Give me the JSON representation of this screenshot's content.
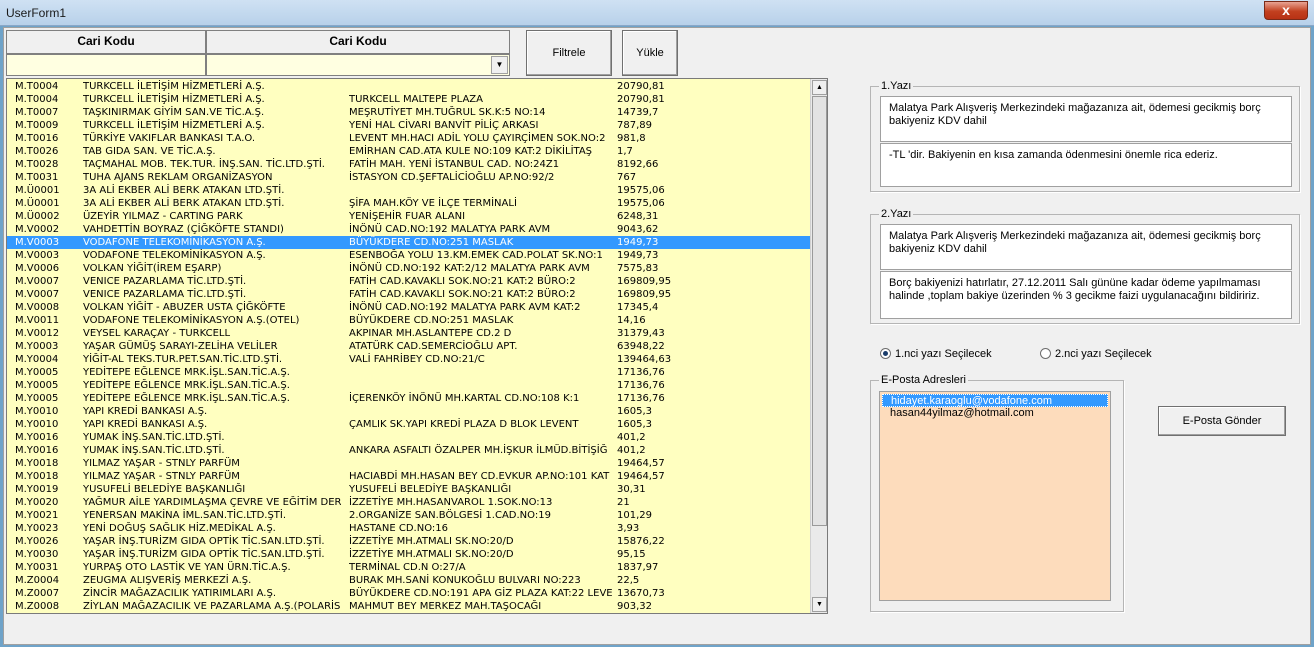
{
  "window": {
    "title": "UserForm1",
    "close_label": "x"
  },
  "filter": {
    "header1": "Cari Kodu",
    "header2": "Cari Kodu",
    "filter_button": "Filtrele",
    "load_button": "Yükle"
  },
  "list": {
    "selected_index": 12,
    "rows": [
      [
        "M.T0004",
        "TURKCELL İLETİŞİM HİZMETLERİ A.Ş.",
        "",
        "20790,81"
      ],
      [
        "M.T0004",
        "TURKCELL İLETİŞİM HİZMETLERİ A.Ş.",
        "TURKCELL MALTEPE PLAZA",
        "20790,81"
      ],
      [
        "M.T0007",
        "TAŞKINIRMAK GİYİM SAN.VE TİC.A.Ş.",
        "MEŞRUTİYET MH.TUĞRUL SK.K:5 NO:14",
        "14739,7"
      ],
      [
        "M.T0009",
        "TURKCELL İLETİŞİM HİZMETLERİ A.Ş.",
        "YENİ HAL CİVARI BANVİT PİLİÇ ARKASI",
        "787,89"
      ],
      [
        "M.T0016",
        "TÜRKİYE VAKIFLAR BANKASI T.A.O.",
        "LEVENT MH.HACI ADİL YOLU ÇAYIRÇİMEN SOK.NO:2",
        "981,8"
      ],
      [
        "M.T0026",
        "TAB GIDA SAN. VE TİC.A.Ş.",
        "EMİRHAN CAD.ATA KULE NO:109 KAT:2 DİKİLİTAŞ",
        "1,7"
      ],
      [
        "M.T0028",
        "TAÇMAHAL MOB. TEK.TUR. İNŞ.SAN. TİC.LTD.ŞTİ.",
        "FATİH MAH. YENİ İSTANBUL CAD. NO:24Z1",
        "8192,66"
      ],
      [
        "M.T0031",
        "TUHA AJANS REKLAM ORGANİZASYON",
        "İSTASYON CD.ŞEFTALİCİOĞLU AP.NO:92/2",
        "767"
      ],
      [
        "M.Ü0001",
        "3A ALİ EKBER ALİ BERK ATAKAN LTD.ŞTİ.",
        "",
        "19575,06"
      ],
      [
        "M.Ü0001",
        "3A ALİ EKBER ALİ BERK ATAKAN LTD.ŞTİ.",
        "ŞİFA MAH.KÖY VE İLÇE TERMİNALİ",
        "19575,06"
      ],
      [
        "M.Ü0002",
        "ÜZEYİR YILMAZ - CARTING PARK",
        "YENİŞEHİR FUAR ALANI",
        "6248,31"
      ],
      [
        "M.V0002",
        "VAHDETTİN BOYRAZ (ÇİĞKÖFTE STANDI)",
        "İNÖNÜ CAD.NO:192 MALATYA PARK AVM",
        "9043,62"
      ],
      [
        "M.V0003",
        "VODAFONE TELEKOMİNİKASYON A.Ş.",
        "BÜYÜKDERE CD.NO:251 MASLAK",
        "1949,73"
      ],
      [
        "M.V0003",
        "VODAFONE TELEKOMİNİKASYON A.Ş.",
        "ESENBOĞA YOLU 13.KM.EMEK CAD.POLAT SK.NO:1",
        "1949,73"
      ],
      [
        "M.V0006",
        "VOLKAN YİĞİT(İREM EŞARP)",
        "İNÖNÜ CD.NO:192 KAT:2/12 MALATYA PARK AVM",
        "7575,83"
      ],
      [
        "M.V0007",
        "VENICE PAZARLAMA TİC.LTD.ŞTİ.",
        "FATİH CAD.KAVAKLI SOK.NO:21 KAT:2 BÜRO:2",
        "169809,95"
      ],
      [
        "M.V0007",
        "VENICE PAZARLAMA TİC.LTD.ŞTİ.",
        "FATİH CAD.KAVAKLI SOK.NO:21 KAT:2 BÜRO:2",
        "169809,95"
      ],
      [
        "M.V0008",
        "VOLKAN YİĞİT - ABUZER USTA ÇİĞKÖFTE",
        "İNÖNÜ CAD.NO:192 MALATYA PARK AVM KAT:2",
        "17345,4"
      ],
      [
        "M.V0011",
        "VODAFONE TELEKOMİNİKASYON A.Ş.(OTEL)",
        "BÜYÜKDERE CD.NO:251 MASLAK",
        "14,16"
      ],
      [
        "M.V0012",
        "VEYSEL KARAÇAY - TURKCELL",
        "AKPINAR MH.ASLANTEPE CD.2 D",
        "31379,43"
      ],
      [
        "M.Y0003",
        "YAŞAR GÜMÜŞ SARAYI-ZELİHA VELİLER",
        "ATATÜRK CAD.SEMERCİOĞLU APT.",
        "63948,22"
      ],
      [
        "M.Y0004",
        "YİĞİT-AL TEKS.TUR.PET.SAN.TİC.LTD.ŞTİ.",
        "VALİ FAHRİBEY CD.NO:21/C",
        "139464,63"
      ],
      [
        "M.Y0005",
        "YEDİTEPE EĞLENCE MRK.İŞL.SAN.TİC.A.Ş.",
        "",
        "17136,76"
      ],
      [
        "M.Y0005",
        "YEDİTEPE EĞLENCE MRK.İŞL.SAN.TİC.A.Ş.",
        "",
        "17136,76"
      ],
      [
        "M.Y0005",
        "YEDİTEPE EĞLENCE MRK.İŞL.SAN.TİC.A.Ş.",
        "İÇERENKÖY İNÖNÜ MH.KARTAL CD.NO:108 K:1",
        "17136,76"
      ],
      [
        "M.Y0010",
        "YAPI KREDİ BANKASI A.Ş.",
        "",
        "1605,3"
      ],
      [
        "M.Y0010",
        "YAPI KREDİ BANKASI A.Ş.",
        "ÇAMLIK SK.YAPI KREDİ PLAZA D BLOK LEVENT",
        "1605,3"
      ],
      [
        "M.Y0016",
        "YUMAK İNŞ.SAN.TİC.LTD.ŞTİ.",
        "",
        "401,2"
      ],
      [
        "M.Y0016",
        "YUMAK İNŞ.SAN.TİC.LTD.ŞTİ.",
        "ANKARA ASFALTI ÖZALPER MH.İŞKUR İLMÜD.BİTİŞİĞ",
        "401,2"
      ],
      [
        "M.Y0018",
        "YILMAZ YAŞAR - STNLY PARFÜM",
        "",
        "19464,57"
      ],
      [
        "M.Y0018",
        "YILMAZ YAŞAR - STNLY PARFÜM",
        "HACIABDİ MH.HASAN BEY CD.EVKUR AP.NO:101 KAT",
        "19464,57"
      ],
      [
        "M.Y0019",
        "YUSUFELİ BELEDİYE BAŞKANLIĞI",
        "YUSUFELİ BELEDİYE BAŞKANLIĞI",
        "30,31"
      ],
      [
        "M.Y0020",
        "YAĞMUR AİLE YARDIMLAŞMA ÇEVRE VE EĞİTİM DERN",
        "İZZETİYE MH.HASANVAROL 1.SOK.NO:13",
        "21"
      ],
      [
        "M.Y0021",
        "YENERSAN MAKİNA İML.SAN.TİC.LTD.ŞTİ.",
        "2.ORGANİZE SAN.BÖLGESİ 1.CAD.NO:19",
        "101,29"
      ],
      [
        "M.Y0023",
        "YENİ DOĞUŞ SAĞLIK HİZ.MEDİKAL A.Ş.",
        "HASTANE CD.NO:16",
        "3,93"
      ],
      [
        "M.Y0026",
        "YAŞAR İNŞ.TURİZM GIDA OPTİK TİC.SAN.LTD.ŞTİ.",
        "İZZETİYE MH.ATMALI SK.NO:20/D",
        "15876,22"
      ],
      [
        "M.Y0030",
        "YAŞAR İNŞ.TURİZM GIDA OPTİK TİC.SAN.LTD.ŞTİ.",
        "İZZETİYE MH.ATMALI SK.NO:20/D",
        "95,15"
      ],
      [
        "M.Y0031",
        "YURPAŞ OTO LASTİK VE YAN ÜRN.TİC.A.Ş.",
        "TERMİNAL CD.N O:27/A",
        "1837,97"
      ],
      [
        "M.Z0004",
        "ZEUGMA ALIŞVERİŞ MERKEZİ A.Ş.",
        "BURAK MH.SANİ KONUKOĞLU BULVARI NO:223",
        "22,5"
      ],
      [
        "M.Z0007",
        "ZİNCİR MAĞAZACILIK YATIRIMLARI A.Ş.",
        "BÜYÜKDERE CD.NO:191 APA GİZ PLAZA KAT:22 LEVE",
        "13670,73"
      ],
      [
        "M.Z0008",
        "ZİYLAN MAĞAZACILIK VE PAZARLAMA A.Ş.(POLARİS)",
        "MAHMUT BEY MERKEZ MAH.TAŞOCAĞI",
        "903,32"
      ]
    ]
  },
  "yazi1": {
    "label": "1.Yazı",
    "text1": "Malatya Park Alışveriş Merkezindeki mağazanıza ait, ödemesi gecikmiş borç bakiyeniz KDV dahil",
    "text2": "-TL 'dir. Bakiyenin en kısa zamanda ödenmesini önemle rica ederiz."
  },
  "yazi2": {
    "label": "2.Yazı",
    "text1": "Malatya Park Alışveriş Merkezindeki mağazanıza ait, ödemesi gecikmiş borç bakiyeniz KDV dahil",
    "text2": "Borç bakiyenizi hatırlatır, 27.12.2011 Salı gününe kadar ödeme yapılmaması halinde ,toplam bakiye üzerinden % 3 gecikme faizi uygulanacağını bildiririz."
  },
  "options": {
    "radio1": "1.nci yazı Seçilecek",
    "radio2": "2.nci yazı Seçilecek",
    "radio1_checked": true
  },
  "email": {
    "label": "E-Posta Adresleri",
    "addresses": [
      "hidayet.karaoglu@vodafone.com",
      "hasan44yilmaz@hotmail.com"
    ],
    "send_button": "E-Posta Gönder"
  }
}
